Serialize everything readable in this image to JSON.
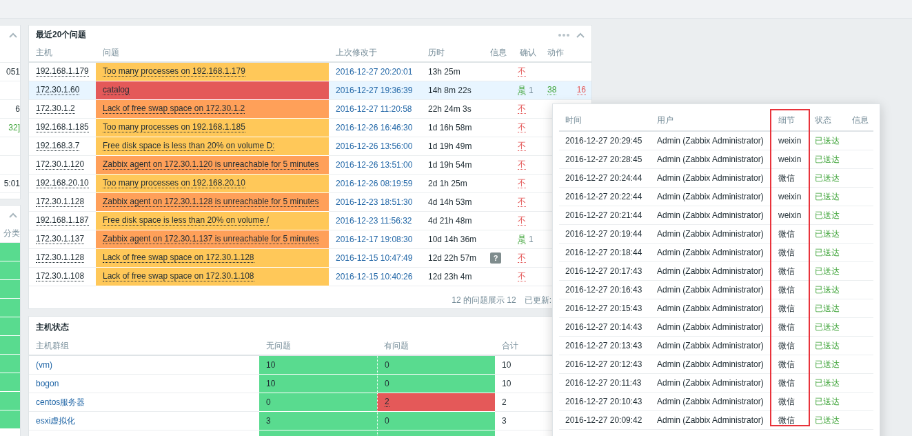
{
  "left_panel": {
    "top_rows": [
      {
        "text": "051",
        "kind": "plain"
      },
      {
        "kind": "empty"
      },
      {
        "text": "6",
        "kind": "plain"
      },
      {
        "text": "32]",
        "kind": "green"
      },
      {
        "kind": "empty"
      },
      {
        "kind": "empty"
      },
      {
        "text": "5:01",
        "kind": "plain"
      }
    ],
    "bottom_header": "分类"
  },
  "problems": {
    "title": "最近20个问题",
    "columns": [
      "主机",
      "问题",
      "上次修改于",
      "历时",
      "信息",
      "确认",
      "动作"
    ],
    "rows": [
      {
        "host": "192.168.1.179",
        "problem": "Too many processes on 192.168.1.179",
        "color": "#ffc859",
        "selected": false,
        "changed": "2016-12-27 20:20:01",
        "duration": "13h 25m",
        "ack": {
          "acknowledged": false,
          "text": "不"
        }
      },
      {
        "host": "172.30.1.60",
        "problem": "catalog",
        "color": "#e45959",
        "selected": true,
        "changed": "2016-12-27 19:36:39",
        "duration": "14h 8m 22s",
        "ack": {
          "acknowledged": true,
          "text": "是",
          "count": "1"
        },
        "actions": [
          {
            "text": "38",
            "color": "#3da337"
          },
          {
            "text": "16",
            "color": "#e45959"
          }
        ]
      },
      {
        "host": "172.30.1.2",
        "problem": "Lack of free swap space on 172.30.1.2",
        "color": "#ffa059",
        "selected": false,
        "changed": "2016-12-27 11:20:58",
        "duration": "22h 24m 3s",
        "ack": {
          "acknowledged": false,
          "text": "不"
        }
      },
      {
        "host": "192.168.1.185",
        "problem": "Too many processes on 192.168.1.185",
        "color": "#ffc859",
        "selected": false,
        "changed": "2016-12-26 16:46:30",
        "duration": "1d 16h 58m",
        "ack": {
          "acknowledged": false,
          "text": "不"
        }
      },
      {
        "host": "192.168.3.7",
        "problem": "Free disk space is less than 20% on volume D:",
        "color": "#ffc859",
        "selected": false,
        "changed": "2016-12-26 13:56:00",
        "duration": "1d 19h 49m",
        "ack": {
          "acknowledged": false,
          "text": "不"
        }
      },
      {
        "host": "172.30.1.120",
        "problem": "Zabbix agent on 172.30.1.120 is unreachable for 5 minutes",
        "color": "#ffa059",
        "selected": false,
        "changed": "2016-12-26 13:51:00",
        "duration": "1d 19h 54m",
        "ack": {
          "acknowledged": false,
          "text": "不"
        }
      },
      {
        "host": "192.168.20.10",
        "problem": "Too many processes on 192.168.20.10",
        "color": "#ffc859",
        "selected": false,
        "changed": "2016-12-26 08:19:59",
        "duration": "2d 1h 25m",
        "ack": {
          "acknowledged": false,
          "text": "不"
        }
      },
      {
        "host": "172.30.1.128",
        "problem": "Zabbix agent on 172.30.1.128 is unreachable for 5 minutes",
        "color": "#ffa059",
        "selected": false,
        "changed": "2016-12-23 18:51:30",
        "duration": "4d 14h 53m",
        "ack": {
          "acknowledged": false,
          "text": "不"
        }
      },
      {
        "host": "192.168.1.187",
        "problem": "Free disk space is less than 20% on volume /",
        "color": "#ffc859",
        "selected": false,
        "changed": "2016-12-23 11:56:32",
        "duration": "4d 21h 48m",
        "ack": {
          "acknowledged": false,
          "text": "不"
        }
      },
      {
        "host": "172.30.1.137",
        "problem": "Zabbix agent on 172.30.1.137 is unreachable for 5 minutes",
        "color": "#ffa059",
        "selected": false,
        "changed": "2016-12-17 19:08:30",
        "duration": "10d 14h 36m",
        "ack": {
          "acknowledged": true,
          "text": "是",
          "count": "1"
        }
      },
      {
        "host": "172.30.1.128",
        "problem": "Lack of free swap space on 172.30.1.128",
        "color": "#ffc859",
        "selected": false,
        "changed": "2016-12-15 10:47:49",
        "duration": "12d 22h 57m",
        "info": "?",
        "ack": {
          "acknowledged": false,
          "text": "不"
        }
      },
      {
        "host": "172.30.1.108",
        "problem": "Lack of free swap space on 172.30.1.108",
        "color": "#ffc859",
        "selected": false,
        "changed": "2016-12-15 10:40:26",
        "duration": "12d 23h 4m",
        "ack": {
          "acknowledged": false,
          "text": "不"
        }
      }
    ],
    "footer": {
      "summary": "12 的问题展示 12",
      "updated": "已更新:"
    }
  },
  "host_status": {
    "title": "主机状态",
    "columns": [
      "主机群组",
      "无问题",
      "有问题",
      "合计"
    ],
    "rows": [
      {
        "group": "(vm)",
        "ok": "10",
        "problems": "0",
        "has_problems": false,
        "total": "10"
      },
      {
        "group": "bogon",
        "ok": "10",
        "problems": "0",
        "has_problems": false,
        "total": "10"
      },
      {
        "group": "centos服务器",
        "ok": "0",
        "problems": "2",
        "has_problems": true,
        "total": "2"
      },
      {
        "group": "esxi虚拟化",
        "ok": "3",
        "problems": "0",
        "has_problems": false,
        "total": "3"
      }
    ]
  },
  "actions_popup": {
    "columns": [
      {
        "label": "时间",
        "highlighted": false
      },
      {
        "label": "用户",
        "highlighted": false
      },
      {
        "label": "细节",
        "highlighted": true
      },
      {
        "label": "状态",
        "highlighted": false
      },
      {
        "label": "信息",
        "highlighted": false
      }
    ],
    "rows": [
      {
        "time": "2016-12-27 20:29:45",
        "user": "Admin (Zabbix Administrator)",
        "detail": "weixin",
        "status": "已送达",
        "kind": "sent"
      },
      {
        "time": "2016-12-27 20:28:45",
        "user": "Admin (Zabbix Administrator)",
        "detail": "weixin",
        "status": "已送达",
        "kind": "sent"
      },
      {
        "time": "2016-12-27 20:24:44",
        "user": "Admin (Zabbix Administrator)",
        "detail": "微信",
        "status": "已送达",
        "kind": "sent"
      },
      {
        "time": "2016-12-27 20:22:44",
        "user": "Admin (Zabbix Administrator)",
        "detail": "weixin",
        "status": "已送达",
        "kind": "sent"
      },
      {
        "time": "2016-12-27 20:21:44",
        "user": "Admin (Zabbix Administrator)",
        "detail": "weixin",
        "status": "已送达",
        "kind": "sent"
      },
      {
        "time": "2016-12-27 20:19:44",
        "user": "Admin (Zabbix Administrator)",
        "detail": "微信",
        "status": "已送达",
        "kind": "sent"
      },
      {
        "time": "2016-12-27 20:18:44",
        "user": "Admin (Zabbix Administrator)",
        "detail": "微信",
        "status": "已送达",
        "kind": "sent"
      },
      {
        "time": "2016-12-27 20:17:43",
        "user": "Admin (Zabbix Administrator)",
        "detail": "微信",
        "status": "已送达",
        "kind": "sent"
      },
      {
        "time": "2016-12-27 20:16:43",
        "user": "Admin (Zabbix Administrator)",
        "detail": "微信",
        "status": "已送达",
        "kind": "sent"
      },
      {
        "time": "2016-12-27 20:15:43",
        "user": "Admin (Zabbix Administrator)",
        "detail": "微信",
        "status": "已送达",
        "kind": "sent"
      },
      {
        "time": "2016-12-27 20:14:43",
        "user": "Admin (Zabbix Administrator)",
        "detail": "微信",
        "status": "已送达",
        "kind": "sent"
      },
      {
        "time": "2016-12-27 20:13:43",
        "user": "Admin (Zabbix Administrator)",
        "detail": "微信",
        "status": "已送达",
        "kind": "sent"
      },
      {
        "time": "2016-12-27 20:12:43",
        "user": "Admin (Zabbix Administrator)",
        "detail": "微信",
        "status": "已送达",
        "kind": "sent"
      },
      {
        "time": "2016-12-27 20:11:43",
        "user": "Admin (Zabbix Administrator)",
        "detail": "微信",
        "status": "已送达",
        "kind": "sent"
      },
      {
        "time": "2016-12-27 20:10:43",
        "user": "Admin (Zabbix Administrator)",
        "detail": "微信",
        "status": "已送达",
        "kind": "sent"
      },
      {
        "time": "2016-12-27 20:09:42",
        "user": "Admin (Zabbix Administrator)",
        "detail": "微信",
        "status": "已送达",
        "kind": "sent"
      }
    ]
  }
}
